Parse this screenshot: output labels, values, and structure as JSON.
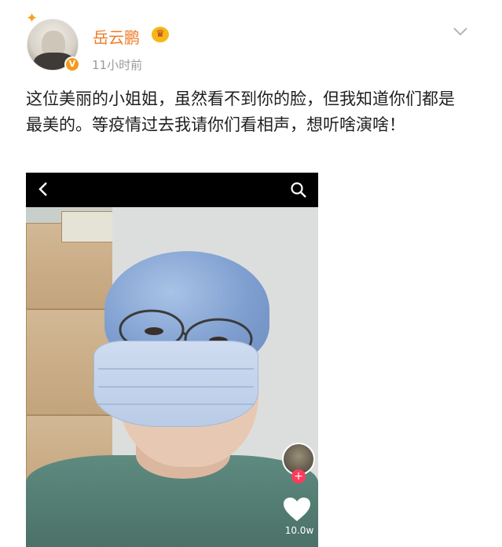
{
  "post": {
    "username": "岳云鹏",
    "timestamp": "11小时前",
    "text": "这位美丽的小姐姐，虽然看不到你的脸，但我知道你们都是最美的。等疫情过去我请你们看相声，想听啥演啥！",
    "verified_badge": "V"
  },
  "video": {
    "like_count": "10.0w",
    "follow_symbol": "+"
  },
  "icons": {
    "sparkle": "sparkle-icon",
    "crown": "crown-icon",
    "chevron": "chevron-down-icon",
    "back": "back-arrow-icon",
    "search": "search-icon",
    "heart": "heart-icon"
  },
  "colors": {
    "username": "#f07b25",
    "timestamp": "#9a9a9a",
    "badge": "#f39a1d"
  }
}
